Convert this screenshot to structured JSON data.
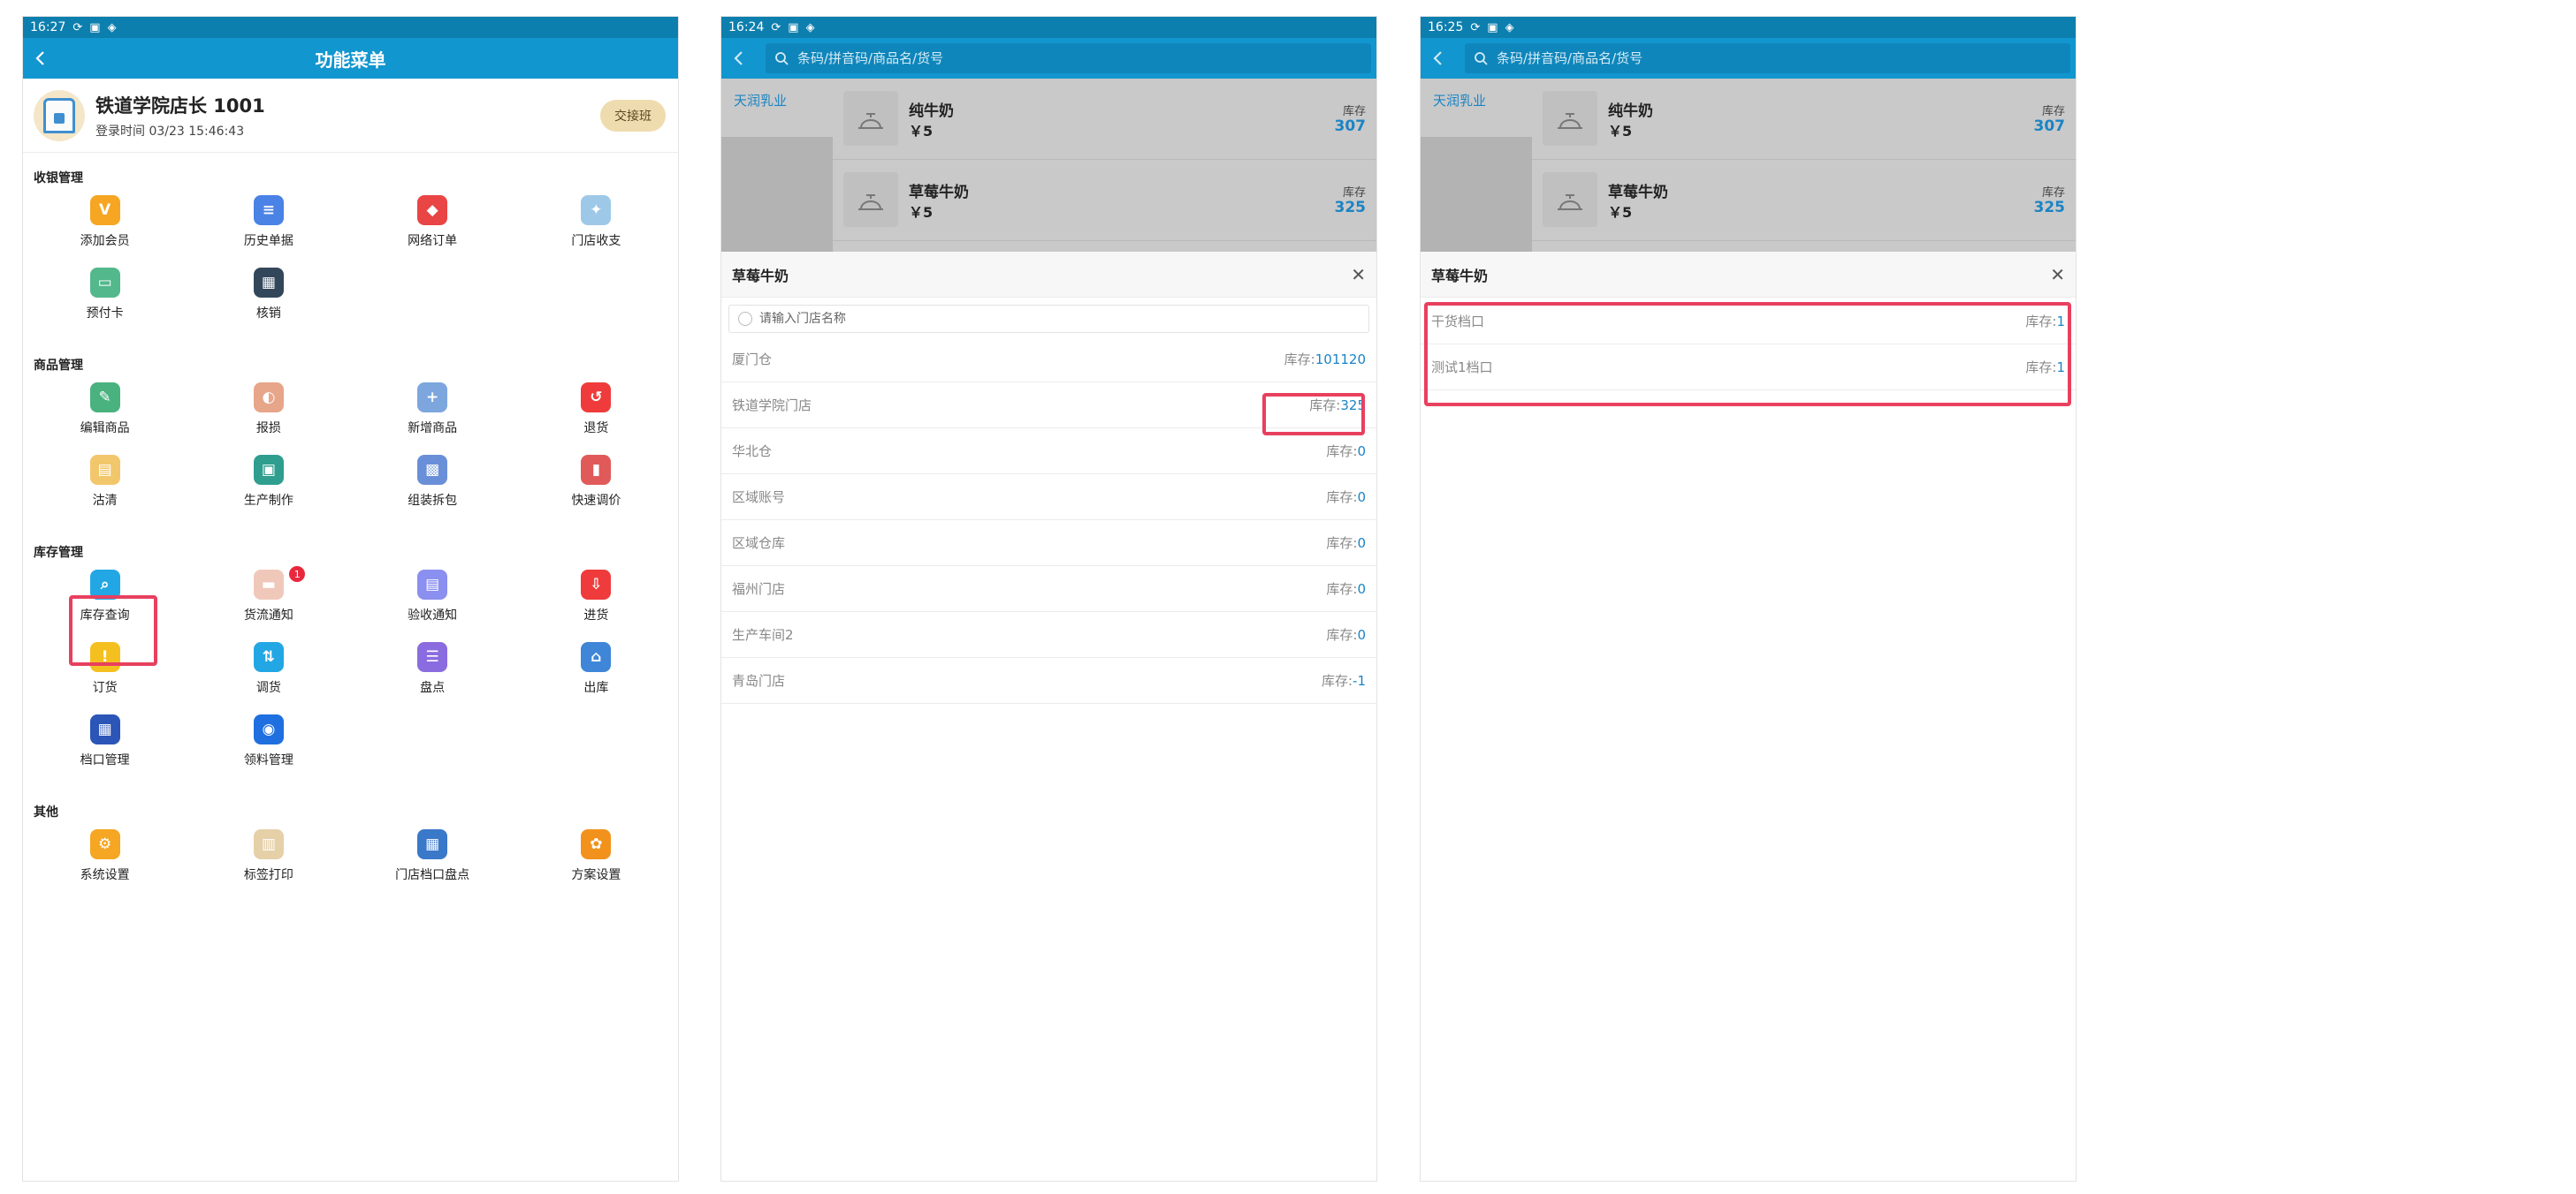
{
  "panel1": {
    "status": {
      "time": "16:27"
    },
    "title": "功能菜单",
    "user": {
      "name": "铁道学院店长 1001",
      "login_time": "登录时间 03/23 15:46:43",
      "shift_button": "交接班"
    },
    "sections": [
      {
        "title": "收银管理",
        "items": [
          {
            "label": "添加会员",
            "icon": "vip-icon",
            "color": "#f6a623",
            "glyph": "V"
          },
          {
            "label": "历史单据",
            "icon": "receipt-history-icon",
            "color": "#4a82e6",
            "glyph": "≡"
          },
          {
            "label": "网络订单",
            "icon": "online-order-icon",
            "color": "#e94545",
            "glyph": "◆"
          },
          {
            "label": "门店收支",
            "icon": "store-finance-icon",
            "color": "#9ec8e8",
            "glyph": "✦"
          },
          {
            "label": "预付卡",
            "icon": "prepaid-card-icon",
            "color": "#53b88c",
            "glyph": "▭"
          },
          {
            "label": "核销",
            "icon": "qrcode-icon",
            "color": "#33475b",
            "glyph": "▦"
          }
        ]
      },
      {
        "title": "商品管理",
        "items": [
          {
            "label": "编辑商品",
            "icon": "edit-product-icon",
            "color": "#49b27e",
            "glyph": "✎"
          },
          {
            "label": "报损",
            "icon": "loss-report-icon",
            "color": "#e7a58a",
            "glyph": "◐"
          },
          {
            "label": "新增商品",
            "icon": "add-product-icon",
            "color": "#7ca6dd",
            "glyph": "+"
          },
          {
            "label": "退货",
            "icon": "return-icon",
            "color": "#ef3b3b",
            "glyph": "↺"
          },
          {
            "label": "沽清",
            "icon": "sold-out-icon",
            "color": "#f2c76b",
            "glyph": "▤"
          },
          {
            "label": "生产制作",
            "icon": "production-icon",
            "color": "#2f9e8f",
            "glyph": "▣"
          },
          {
            "label": "组装拆包",
            "icon": "assembly-icon",
            "color": "#6a8fd9",
            "glyph": "▩"
          },
          {
            "label": "快速调价",
            "icon": "price-adjust-icon",
            "color": "#e05a5a",
            "glyph": "▮"
          }
        ]
      },
      {
        "title": "库存管理",
        "items": [
          {
            "label": "库存查询",
            "icon": "inventory-search-icon",
            "color": "#22a7e4",
            "glyph": "⌕"
          },
          {
            "label": "货流通知",
            "icon": "goods-flow-icon",
            "color": "#f0c8ba",
            "glyph": "▬",
            "badge": "1"
          },
          {
            "label": "验收通知",
            "icon": "acceptance-icon",
            "color": "#8a8ff0",
            "glyph": "▤"
          },
          {
            "label": "进货",
            "icon": "purchase-icon",
            "color": "#ef3b3b",
            "glyph": "⇩"
          },
          {
            "label": "订货",
            "icon": "order-icon",
            "color": "#f4c020",
            "glyph": "!"
          },
          {
            "label": "调货",
            "icon": "transfer-icon",
            "color": "#22a7e4",
            "glyph": "⇅"
          },
          {
            "label": "盘点",
            "icon": "stocktake-icon",
            "color": "#8b6ce0",
            "glyph": "☰"
          },
          {
            "label": "出库",
            "icon": "outbound-icon",
            "color": "#3f86d8",
            "glyph": "⌂"
          },
          {
            "label": "档口管理",
            "icon": "stall-manage-icon",
            "color": "#2b55b6",
            "glyph": "▦"
          },
          {
            "label": "领料管理",
            "icon": "material-manage-icon",
            "color": "#1f6fe0",
            "glyph": "◉"
          }
        ]
      },
      {
        "title": "其他",
        "items": [
          {
            "label": "系统设置",
            "icon": "gears-icon",
            "color": "#f5a623",
            "glyph": "⚙"
          },
          {
            "label": "标签打印",
            "icon": "label-print-icon",
            "color": "#e6d0a8",
            "glyph": "▥"
          },
          {
            "label": "门店档口盘点",
            "icon": "stall-stocktake-icon",
            "color": "#3a78c9",
            "glyph": "▦"
          },
          {
            "label": "方案设置",
            "icon": "settings-icon",
            "color": "#f2921c",
            "glyph": "✿"
          }
        ]
      }
    ]
  },
  "panel2": {
    "status": {
      "time": "16:24"
    },
    "search_placeholder": "条码/拼音码/商品名/货号",
    "category": "天润乳业",
    "products": [
      {
        "name": "纯牛奶",
        "price": "￥5",
        "stock_label": "库存",
        "stock": "307"
      },
      {
        "name": "草莓牛奶",
        "price": "￥5",
        "stock_label": "库存",
        "stock": "325"
      }
    ],
    "sheet": {
      "title": "草莓牛奶",
      "search_placeholder": "请输入门店名称",
      "rows": [
        {
          "name": "厦门仓",
          "stock_label": "库存:",
          "value": "101120"
        },
        {
          "name": "铁道学院门店",
          "stock_label": "库存:",
          "value": "325"
        },
        {
          "name": "华北仓",
          "stock_label": "库存:",
          "value": "0"
        },
        {
          "name": "区域账号",
          "stock_label": "库存:",
          "value": "0"
        },
        {
          "name": "区域仓库",
          "stock_label": "库存:",
          "value": "0"
        },
        {
          "name": "福州门店",
          "stock_label": "库存:",
          "value": "0"
        },
        {
          "name": "生产车间2",
          "stock_label": "库存:",
          "value": "0"
        },
        {
          "name": "青岛门店",
          "stock_label": "库存:",
          "value": "-1"
        }
      ]
    }
  },
  "panel3": {
    "status": {
      "time": "16:25"
    },
    "search_placeholder": "条码/拼音码/商品名/货号",
    "category": "天润乳业",
    "products": [
      {
        "name": "纯牛奶",
        "price": "￥5",
        "stock_label": "库存",
        "stock": "307"
      },
      {
        "name": "草莓牛奶",
        "price": "￥5",
        "stock_label": "库存",
        "stock": "325"
      }
    ],
    "sheet": {
      "title": "草莓牛奶",
      "rows": [
        {
          "name": "干货档口",
          "stock_label": "库存:",
          "value": "1"
        },
        {
          "name": "测试1档口",
          "stock_label": "库存:",
          "value": "1"
        }
      ]
    }
  },
  "colors": {
    "appbar": "#1296cf",
    "statusbar": "#0d7fae",
    "highlight": "#e8405f",
    "stock_value": "#1a84c4"
  }
}
